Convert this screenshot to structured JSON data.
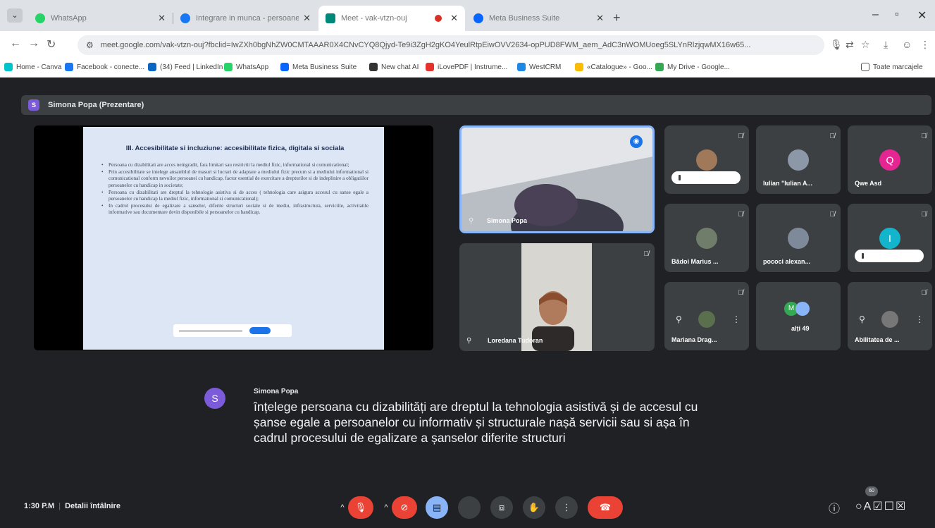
{
  "browser": {
    "tabs": [
      {
        "title": "WhatsApp",
        "color": "#25d366"
      },
      {
        "title": "Integrare in munca - persoane",
        "color": "#1877f2"
      },
      {
        "title": "Meet - vak-vtzn-ouj",
        "color": "#00897b"
      },
      {
        "title": "Meta Business Suite",
        "color": "#0866ff"
      }
    ],
    "url": "meet.google.com/vak-vtzn-ouj?fbclid=IwZXh0bgNhZW0CMTAAAR0X4CNvCYQ8Qjyd-Te9i3ZgH2gKO4YeulRtpEiwOVV2634-opPUD8FWM_aem_AdC3nWOMUoeg5SLYnRlzjqwMX16w65...",
    "bookmarks": [
      {
        "label": "Home - Canva",
        "color": "#00c4cc"
      },
      {
        "label": "Facebook - conecte...",
        "color": "#1877f2"
      },
      {
        "label": "(34) Feed | LinkedIn",
        "color": "#0a66c2"
      },
      {
        "label": "WhatsApp",
        "color": "#25d366"
      },
      {
        "label": "Meta Business Suite",
        "color": "#0866ff"
      },
      {
        "label": "New chat AI",
        "color": "#333333"
      },
      {
        "label": "iLovePDF | Instrume...",
        "color": "#e5322d"
      },
      {
        "label": "WestCRM",
        "color": "#1e88e5"
      },
      {
        "label": "«Catalogue» - Goo...",
        "color": "#fbbc04"
      },
      {
        "label": "My Drive - Google...",
        "color": "#34a853"
      }
    ],
    "all_bookmarks": "Toate marcajele"
  },
  "meet": {
    "presenter_initial": "S",
    "presenter_label": "Simona Popa (Prezentare)",
    "slide": {
      "title": "III. Accesibilitate si incluziune: accesibilitate fizica, digitala si sociala",
      "bullets": [
        "Persoana cu dizabilitati are acces neingradit, fara limitari sau restrictii la mediul fizic, informational si comunicational;",
        "Prin accesibilitate se intelege ansamblul de masuri si lucrari de adaptare a mediului fizic precum si a mediului informational si comunicational conform nevoilor persoanei cu handicap, factor esential de exercitare a drepturilor si de indeplinire a obligatiilor persoanelor cu handicap in societate;",
        "Persoana cu dizabilitati are dreptul la tehnologie asistiva si de acces ( tehnologia care asigura accesul cu sanse egale a persoanelor cu handicap la mediul fizic, informational si comunicational);",
        "In cadrul procesului de egalizare a sanselor, diferite structuri sociale si de mediu, infrastructura, serviciile, activitatile informative sau documentare devin disponibile si persoanelor cu handicap."
      ]
    },
    "tiles": {
      "speaker": "Simona Popa",
      "second": "Loredana Tudoran",
      "grid": [
        {
          "name": ""
        },
        {
          "name": "Iulian \"Iulian A..."
        },
        {
          "name": "Qwe Asd",
          "initial": "Q",
          "color": "#e52592"
        },
        {
          "name": "Bădoi Marius ..."
        },
        {
          "name": "pococi alexan..."
        },
        {
          "name": "",
          "initial": "I",
          "color": "#12b5cb"
        },
        {
          "name": "Mariana Drag..."
        },
        {
          "name": "alți 49",
          "initial": "M"
        },
        {
          "name": "Abilitatea de ..."
        }
      ]
    },
    "caption": {
      "initial": "S",
      "speaker": "Simona Popa",
      "text": "înțelege persoana cu dizabilități are dreptul la tehnologia asistivă și de accesul cu șanse egale a persoanelor cu informativ și structurale nașă servicii sau si așa în cadrul procesului de egalizare a șanselor diferite structuri"
    },
    "bottom": {
      "time": "1:30 P.M",
      "details": "Detalii întâlnire",
      "people_count": "60"
    }
  }
}
